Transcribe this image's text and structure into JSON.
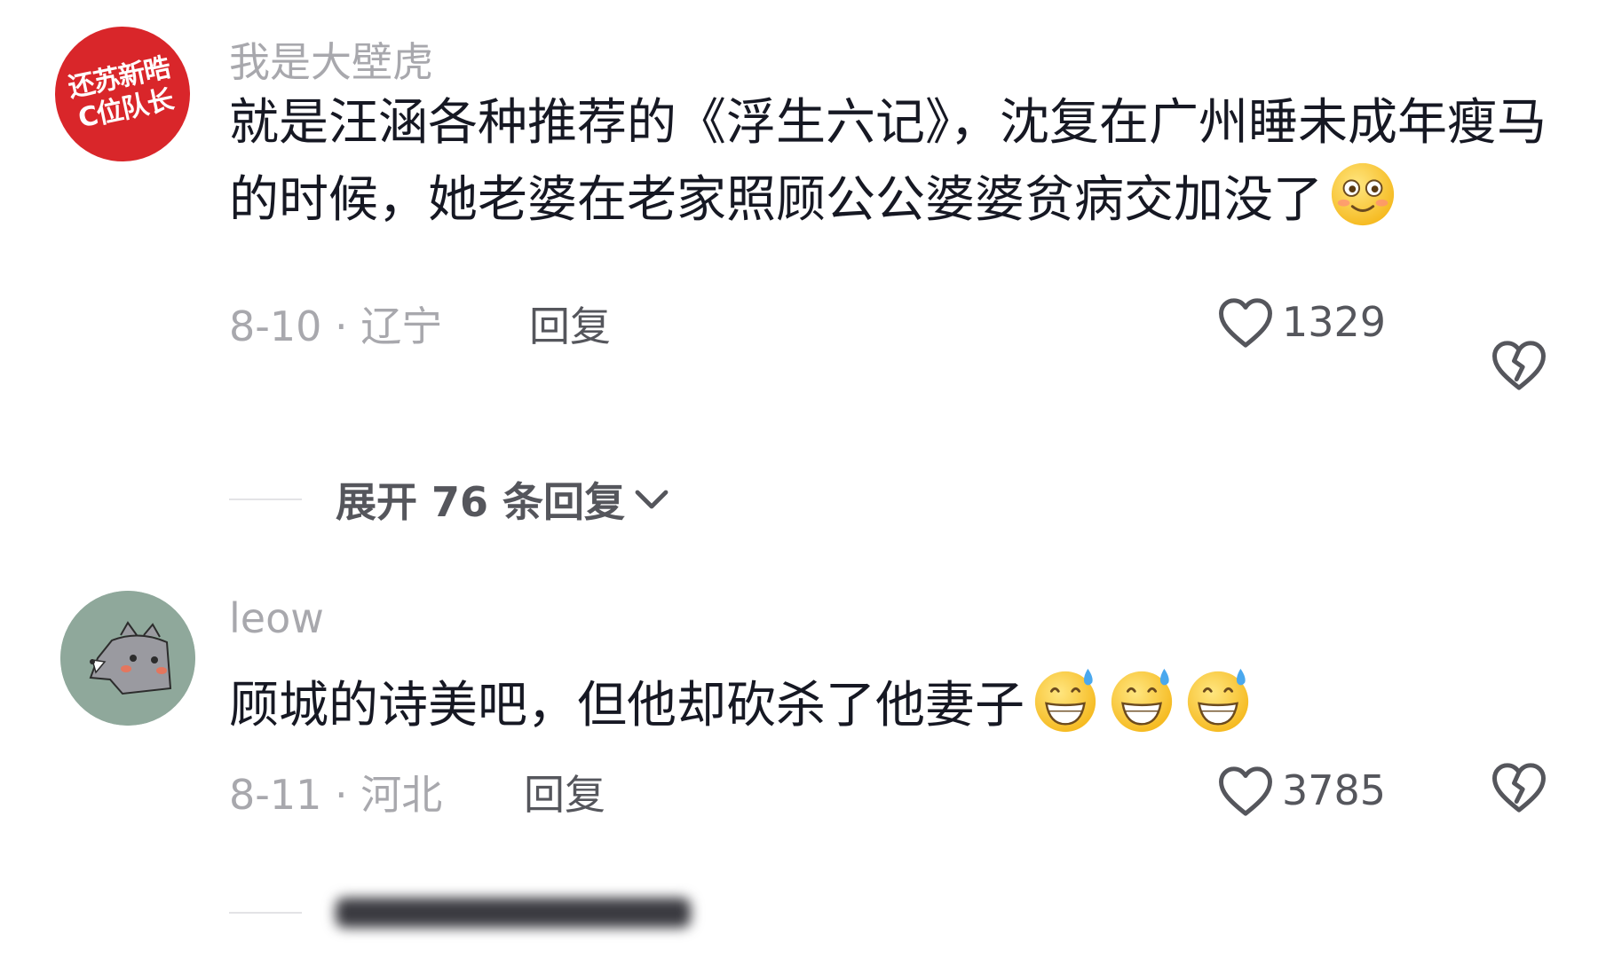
{
  "comments": [
    {
      "avatar_lines": [
        "还苏新晧",
        "C位队长"
      ],
      "avatar_color": "#d9262a",
      "username": "我是大壁虎",
      "text": "就是汪涵各种推荐的《浮生六记》，沈复在广州睡未成年瘦马的时候，她老婆在老家照顾公公婆婆贫病交加没了",
      "emoji_icons": [
        "smiling-blush-emoji-icon"
      ],
      "date_location": "8-10 · 辽宁",
      "reply_label": "回复",
      "likes": "1329",
      "expand_label": "展开 76 条回复"
    },
    {
      "avatar_color": "#8fa89b",
      "avatar_icon": "wolf-avatar-icon",
      "username": "leow",
      "text": "顾城的诗美吧，但他却砍杀了他妻子",
      "emoji_icons": [
        "grinning-sweat-emoji-icon",
        "grinning-sweat-emoji-icon",
        "grinning-sweat-emoji-icon"
      ],
      "date_location": "8-11 · 河北",
      "reply_label": "回复",
      "likes": "3785"
    }
  ],
  "icons": {
    "like": "heart-outline-icon",
    "dislike": "broken-heart-icon",
    "expand": "chevron-down-icon"
  },
  "colors": {
    "text": "#161823",
    "muted": "#a8a8ad",
    "secondary": "#55565c"
  }
}
